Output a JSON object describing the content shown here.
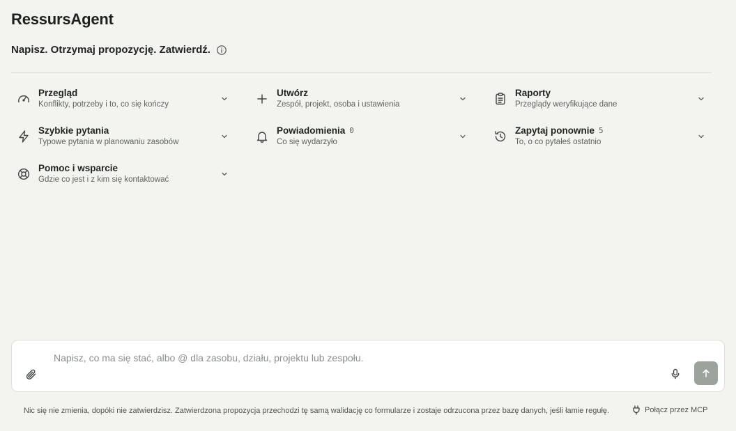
{
  "app": {
    "title": "RessursAgent",
    "tagline": "Napisz. Otrzymaj propozycję. Zatwierdź."
  },
  "categories": [
    {
      "icon": "gauge-icon",
      "title": "Przegląd",
      "subtitle": "Konflikty, potrzeby i to, co się kończy",
      "count": ""
    },
    {
      "icon": "plus-icon",
      "title": "Utwórz",
      "subtitle": "Zespół, projekt, osoba i ustawienia",
      "count": ""
    },
    {
      "icon": "clipboard-icon",
      "title": "Raporty",
      "subtitle": "Przeglądy weryfikujące dane",
      "count": ""
    },
    {
      "icon": "lightning-icon",
      "title": "Szybkie pytania",
      "subtitle": "Typowe pytania w planowaniu zasobów",
      "count": ""
    },
    {
      "icon": "bell-icon",
      "title": "Powiadomienia",
      "subtitle": "Co się wydarzyło",
      "count": "0"
    },
    {
      "icon": "history-icon",
      "title": "Zapytaj ponownie",
      "subtitle": "To, o co pytałeś ostatnio",
      "count": "5"
    },
    {
      "icon": "lifebuoy-icon",
      "title": "Pomoc i wsparcie",
      "subtitle": "Gdzie co jest i z kim się kontaktować",
      "count": ""
    }
  ],
  "composer": {
    "placeholder": "Napisz, co ma się stać, albo @ dla zasobu, działu, projektu lub zespołu.",
    "value": ""
  },
  "footer": {
    "note": "Nic się nie zmienia, dopóki nie zatwierdzisz. Zatwierdzona propozycja przechodzi tę samą walidację co formularze i zostaje odrzucona przez bazę danych, jeśli łamie regułę.",
    "mcp_label": "Połącz przez MCP"
  },
  "colors": {
    "background": "#f3f3f0",
    "send_button": "#9ba39c",
    "text": "#1f2421",
    "muted_text": "#5e635f"
  }
}
